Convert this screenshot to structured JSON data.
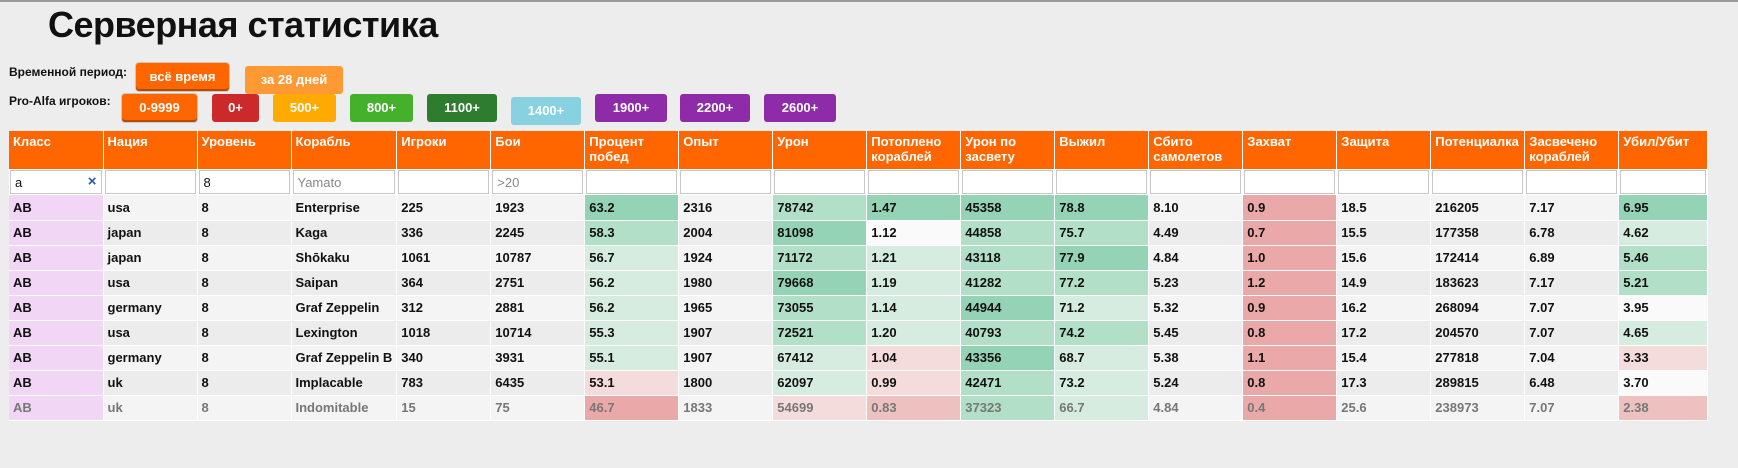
{
  "page": {
    "title": "Серверная статистика"
  },
  "period": {
    "label": "Временной период:",
    "buttons": [
      {
        "label": "всё время",
        "color": "#ff6600",
        "selected": true
      },
      {
        "label": "за 28 дней",
        "color": "#ff9933",
        "selected": false
      }
    ]
  },
  "proalfa": {
    "label": "Pro-Alfa игроков:",
    "buttons": [
      {
        "label": "0-9999",
        "color": "#ff6600",
        "selected": true
      },
      {
        "label": "0+",
        "color": "#cc2a2a",
        "selected": false
      },
      {
        "label": "500+",
        "color": "#ffaa00",
        "selected": false
      },
      {
        "label": "800+",
        "color": "#44b02c",
        "selected": false
      },
      {
        "label": "1100+",
        "color": "#2e7d2e",
        "selected": false
      },
      {
        "label": "1400+",
        "color": "#88d1e0",
        "selected": false
      },
      {
        "label": "1900+",
        "color": "#8e2ba8",
        "selected": false
      },
      {
        "label": "2200+",
        "color": "#8e2ba8",
        "selected": false
      },
      {
        "label": "2600+",
        "color": "#8e2ba8",
        "selected": false
      }
    ]
  },
  "table": {
    "columns": [
      "Класс",
      "Нация",
      "Уровень",
      "Корабль",
      "Игроки",
      "Бои",
      "Процент побед",
      "Опыт",
      "Урон",
      "Потоплено кораблей",
      "Урон по засвету",
      "Выжил",
      "Сбито самолетов",
      "Захват",
      "Защита",
      "Потенциалка",
      "Засвечено кораблей",
      "Убил/Убит"
    ],
    "filters": [
      {
        "value": "а",
        "placeholder": "",
        "clear_icon": "×"
      },
      {
        "value": "",
        "placeholder": ""
      },
      {
        "value": "8",
        "placeholder": ""
      },
      {
        "value": "",
        "placeholder": "Yamato"
      },
      {
        "value": "",
        "placeholder": ""
      },
      {
        "value": "",
        "placeholder": ">20"
      },
      {
        "value": "",
        "placeholder": ""
      },
      {
        "value": "",
        "placeholder": ""
      },
      {
        "value": "",
        "placeholder": ""
      },
      {
        "value": "",
        "placeholder": ""
      },
      {
        "value": "",
        "placeholder": ""
      },
      {
        "value": "",
        "placeholder": ""
      },
      {
        "value": "",
        "placeholder": ""
      },
      {
        "value": "",
        "placeholder": ""
      },
      {
        "value": "",
        "placeholder": ""
      },
      {
        "value": "",
        "placeholder": ""
      },
      {
        "value": "",
        "placeholder": ""
      },
      {
        "value": "",
        "placeholder": ""
      }
    ],
    "rows": [
      [
        "АВ",
        "usa",
        "8",
        "Enterprise",
        "225",
        "1923",
        "63.2",
        "2316",
        "78742",
        "1.47",
        "45358",
        "78.8",
        "8.10",
        "0.9",
        "18.5",
        "216205",
        "7.17",
        "6.95"
      ],
      [
        "АВ",
        "japan",
        "8",
        "Kaga",
        "336",
        "2245",
        "58.3",
        "2004",
        "81098",
        "1.12",
        "44858",
        "75.7",
        "4.49",
        "0.7",
        "15.5",
        "177358",
        "6.78",
        "4.62"
      ],
      [
        "АВ",
        "japan",
        "8",
        "Shōkaku",
        "1061",
        "10787",
        "56.7",
        "1924",
        "71172",
        "1.21",
        "43118",
        "77.9",
        "4.84",
        "1.0",
        "15.6",
        "172414",
        "6.89",
        "5.46"
      ],
      [
        "АВ",
        "usa",
        "8",
        "Saipan",
        "364",
        "2751",
        "56.2",
        "1980",
        "79668",
        "1.19",
        "41282",
        "77.2",
        "5.23",
        "1.2",
        "14.9",
        "183623",
        "7.17",
        "5.21"
      ],
      [
        "АВ",
        "germany",
        "8",
        "Graf Zeppelin",
        "312",
        "2881",
        "56.2",
        "1965",
        "73055",
        "1.14",
        "44944",
        "71.2",
        "5.32",
        "0.9",
        "16.2",
        "268094",
        "7.07",
        "3.95"
      ],
      [
        "АВ",
        "usa",
        "8",
        "Lexington",
        "1018",
        "10714",
        "55.3",
        "1907",
        "72521",
        "1.20",
        "40793",
        "74.2",
        "5.45",
        "0.8",
        "17.2",
        "204570",
        "7.07",
        "4.65"
      ],
      [
        "АВ",
        "germany",
        "8",
        "Graf Zeppelin B",
        "340",
        "3931",
        "55.1",
        "1907",
        "67412",
        "1.04",
        "43356",
        "68.7",
        "5.38",
        "1.1",
        "15.4",
        "277818",
        "7.04",
        "3.33"
      ],
      [
        "АВ",
        "uk",
        "8",
        "Implacable",
        "783",
        "6435",
        "53.1",
        "1800",
        "62097",
        "0.99",
        "42471",
        "73.2",
        "5.24",
        "0.8",
        "17.3",
        "289815",
        "6.48",
        "3.70"
      ],
      [
        "АВ",
        "uk",
        "8",
        "Indomitable",
        "15",
        "75",
        "46.7",
        "1833",
        "54699",
        "0.83",
        "37323",
        "66.7",
        "4.84",
        "0.4",
        "25.6",
        "238973",
        "7.07",
        "2.38"
      ]
    ],
    "heat": [
      {
        "6": "g3",
        "8": "g2",
        "9": "g3",
        "10": "g3",
        "11": "g3",
        "13": "r3",
        "17": "g3"
      },
      {
        "6": "g2",
        "8": "g3",
        "9": "w0",
        "10": "g2",
        "11": "g2",
        "13": "r3",
        "17": "g1"
      },
      {
        "6": "g1",
        "8": "g2",
        "9": "g1",
        "10": "g2",
        "11": "g3",
        "13": "r3",
        "17": "g2"
      },
      {
        "6": "g1",
        "8": "g3",
        "9": "g1",
        "10": "g2",
        "11": "g2",
        "13": "r3",
        "17": "g2"
      },
      {
        "6": "g1",
        "8": "g2",
        "9": "g1",
        "10": "g3",
        "11": "g1",
        "13": "r3",
        "17": "w0"
      },
      {
        "6": "g1",
        "8": "g2",
        "9": "g1",
        "10": "g2",
        "11": "g2",
        "13": "r3",
        "17": "g1"
      },
      {
        "6": "g1",
        "8": "g1",
        "9": "r1",
        "10": "g3",
        "11": "g1",
        "13": "r3",
        "17": "r1"
      },
      {
        "6": "r1",
        "8": "g1",
        "9": "r1",
        "10": "g2",
        "11": "g1",
        "13": "r3",
        "17": "w0"
      },
      {
        "6": "r3",
        "8": "r1",
        "9": "r2",
        "10": "g2",
        "11": "g1",
        "13": "r3",
        "17": "r2"
      }
    ],
    "dim_rows": [
      8
    ]
  }
}
